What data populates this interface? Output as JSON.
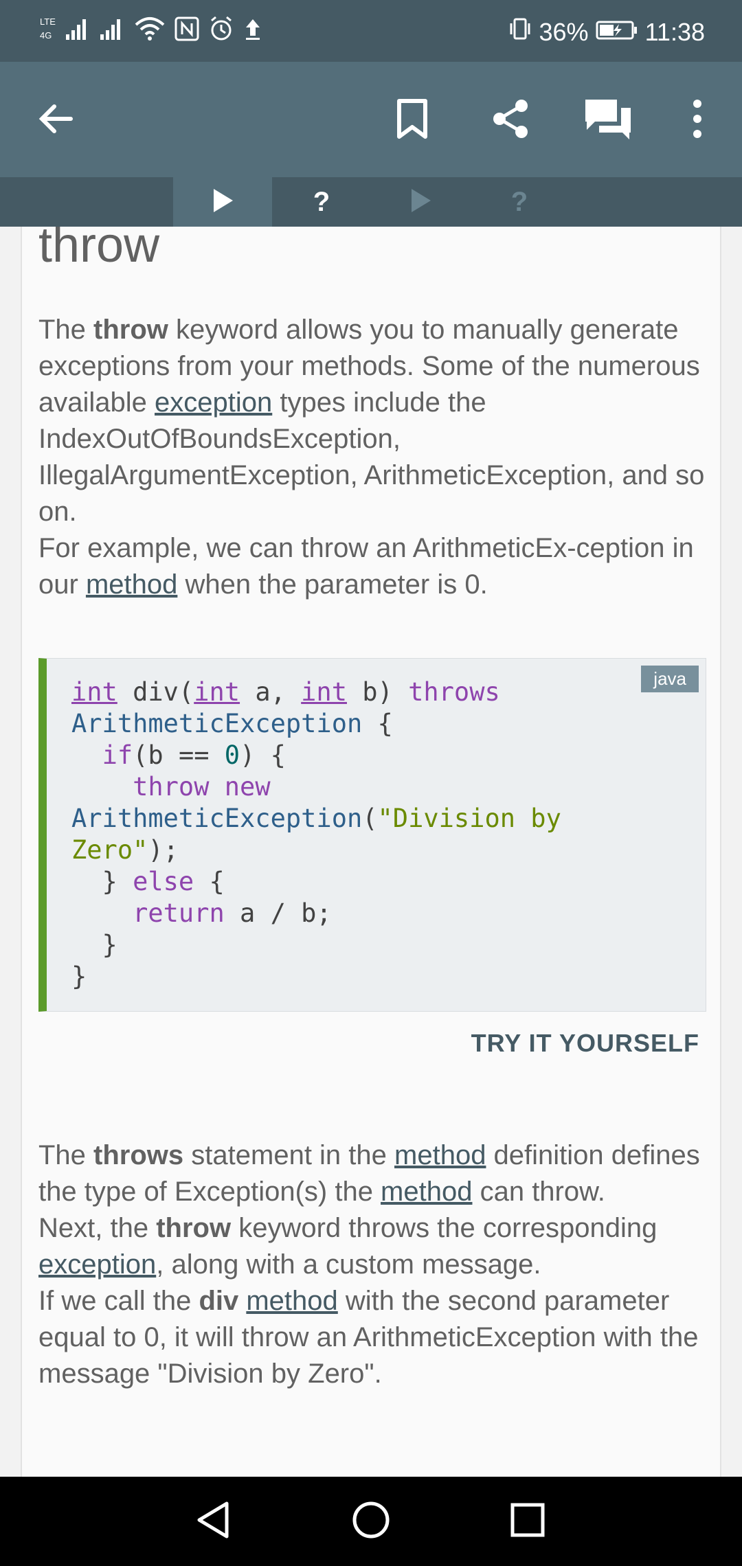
{
  "status_bar": {
    "battery": "36%",
    "time": "11:38",
    "icons": [
      "lte-signal-icon",
      "signal-icon",
      "wifi-icon",
      "nfc-icon",
      "alarm-icon",
      "upload-icon",
      "vibrate-icon",
      "battery-icon"
    ]
  },
  "app_bar": {
    "icons": [
      "back-arrow-icon",
      "bookmark-icon",
      "share-icon",
      "comments-icon",
      "more-vert-icon"
    ]
  },
  "lesson_tabs": [
    {
      "icon": "play-icon",
      "active": true
    },
    {
      "label": "?",
      "active": false
    },
    {
      "icon": "play-icon",
      "active": false
    },
    {
      "label": "?",
      "active": false
    }
  ],
  "content": {
    "heading": "throw",
    "p1": {
      "t1": "The ",
      "b1": "throw",
      "t2": " keyword allows you to manually generate exceptions from your methods. Some of the numerous available ",
      "link1": "exception",
      "t3": " types include the IndexOutOfBoundsException, IllegalArgumentException, ArithmeticException, and so on.",
      "t4": "For example, we can throw an ArithmeticEx-ception in our ",
      "link2": "method",
      "t5": " when the parameter is 0."
    },
    "code": {
      "language": "java",
      "tokens": {
        "int": "int",
        "div_open": " div(",
        "a_comma": " a, ",
        "b_close": " b) ",
        "throws": "throws",
        "arith": "ArithmeticException",
        "brace_open": " {",
        "indent1": "  ",
        "if": "if",
        "cond_open": "(b == ",
        "zero": "0",
        "cond_close": ") {",
        "indent2": "    ",
        "throw": "throw",
        "space": " ",
        "new": "new",
        "paren_open": "(",
        "str1": "\"Division by",
        "str2": "Zero\"",
        "end_stmt": ");",
        "close_else": "  } ",
        "else": "else",
        "return": "return",
        "ret_expr": " a / b;",
        "close_inner": "  }",
        "close_outer": "}"
      }
    },
    "try_label": "TRY IT YOURSELF",
    "p2": {
      "t1": "The ",
      "b1": "throws",
      "t2": " statement in the ",
      "link1": "method",
      "t3": " definition defines the type of Exception(s) the ",
      "link2": "method",
      "t4": " can throw.",
      "t5": "Next, the ",
      "b2": "throw",
      "t6": " keyword throws the corresponding ",
      "link3": "exception",
      "t7": ", along with a custom message.",
      "t8": "If we call the ",
      "b3": "div",
      "t9": " ",
      "link4": "method",
      "t10": " with the second parameter equal to 0, it will throw an ArithmeticException with the message \"Division by Zero\"."
    }
  },
  "nav_bar": {
    "icons": [
      "back-triangle-icon",
      "home-circle-icon",
      "recents-square-icon"
    ]
  }
}
